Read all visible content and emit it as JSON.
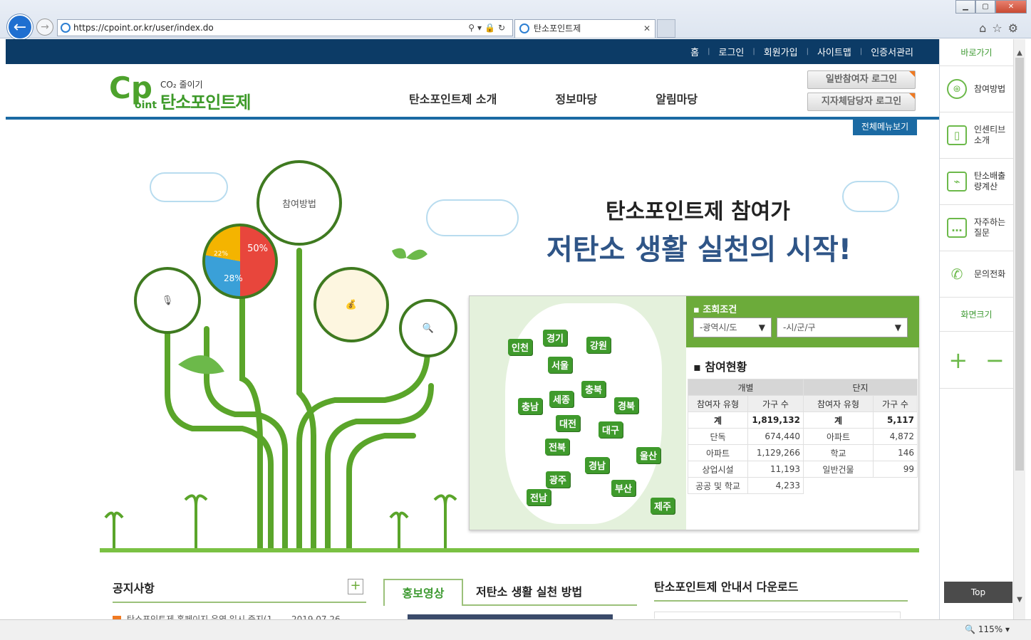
{
  "browser": {
    "url": "https://cpoint.or.kr/user/index.do",
    "tab_title": "탄소포인트제",
    "zoom": "115%"
  },
  "topnav": [
    "홈",
    "로그인",
    "회원가입",
    "사이트맵",
    "인증서관리"
  ],
  "logo": {
    "top": "CO₂ 줄이기",
    "name": "탄소포인트제",
    "oint": "oint"
  },
  "gnb": [
    "탄소포인트제 소개",
    "정보마당",
    "알림마당"
  ],
  "login_buttons": [
    "일반참여자 로그인",
    "지자체담당자 로그인"
  ],
  "all_menu": "전체메뉴보기",
  "sidebar": {
    "title": "바로가기",
    "items": [
      "참여방법",
      "인센티브\n소개",
      "탄소배출\n량계산",
      "자주하는\n질문",
      "문의전화"
    ],
    "screen_size": "화면크기",
    "zoom_in": "+",
    "zoom_out": "−",
    "top": "Top"
  },
  "visual": {
    "headline1": "탄소포인트제 참여가",
    "headline2": "저탄소 생활 실천의 시작!",
    "circle_label": "참여방법",
    "pie": {
      "a": "50%",
      "b": "28%",
      "c": "22%"
    }
  },
  "regions": [
    "인천",
    "경기",
    "강원",
    "서울",
    "충남",
    "세종",
    "충북",
    "경북",
    "대전",
    "대구",
    "전북",
    "울산",
    "경남",
    "광주",
    "부산",
    "전남",
    "제주"
  ],
  "filter": {
    "label": "조회조건",
    "sido": "-광역시/도",
    "sigungu": "-시/군/구"
  },
  "stats": {
    "title": "참여현황",
    "group_individual": "개별",
    "group_complex": "단지",
    "col_type": "참여자 유형",
    "col_households": "가구 수",
    "individual": [
      [
        "계",
        "1,819,132"
      ],
      [
        "단독",
        "674,440"
      ],
      [
        "아파트",
        "1,129,266"
      ],
      [
        "상업시설",
        "11,193"
      ],
      [
        "공공 및 학교",
        "4,233"
      ]
    ],
    "complex": [
      [
        "계",
        "5,117"
      ],
      [
        "아파트",
        "4,872"
      ],
      [
        "학교",
        "146"
      ],
      [
        "일반건물",
        "99"
      ],
      [
        "",
        ""
      ]
    ]
  },
  "notice": {
    "title": "공지사항",
    "row_text": "탄소포인트제 홈페이지 운영 일시 중지(1...",
    "row_date": "2019.07.26"
  },
  "video": {
    "tab_on": "홍보영상",
    "tab_off": "저탄소 생활 실천 방법"
  },
  "download": {
    "title": "탄소포인트제 안내서 다운로드"
  }
}
